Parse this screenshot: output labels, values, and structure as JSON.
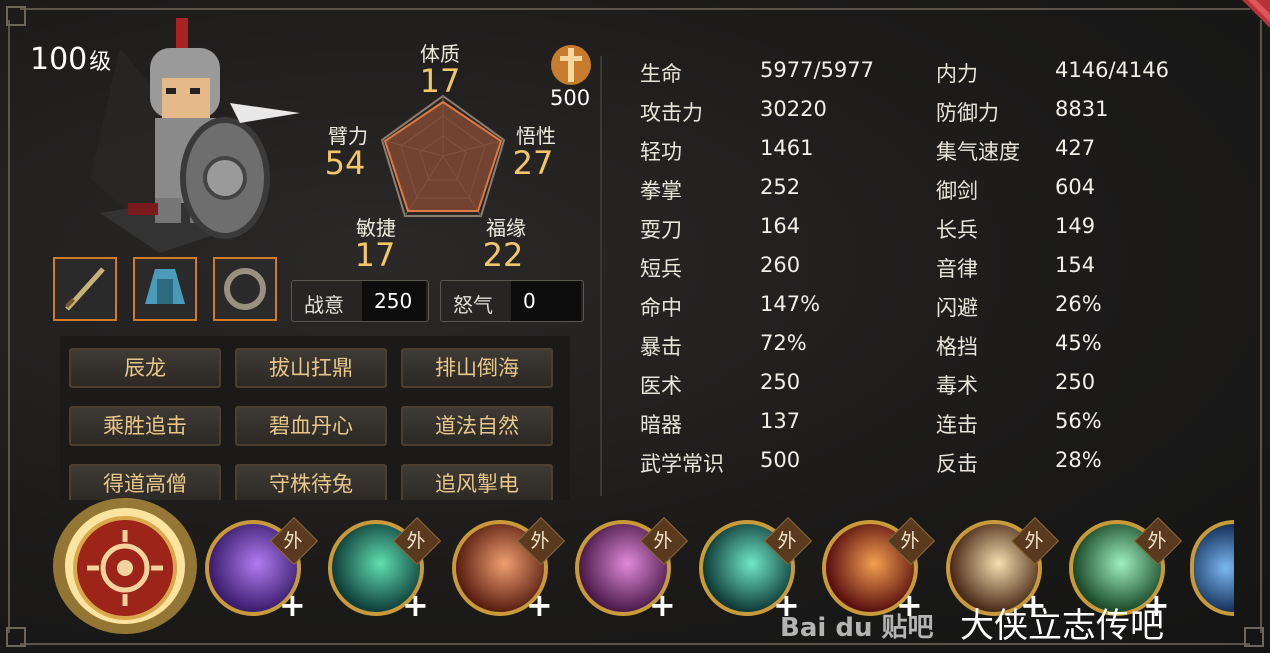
{
  "header": {
    "level_number": "100",
    "level_suffix": "级"
  },
  "badge": {
    "value": "500"
  },
  "attributes": {
    "tizhi": {
      "label": "体质",
      "value": "17"
    },
    "bili": {
      "label": "臂力",
      "value": "54"
    },
    "wuxing": {
      "label": "悟性",
      "value": "27"
    },
    "minjie": {
      "label": "敏捷",
      "value": "17"
    },
    "fuyuan": {
      "label": "福缘",
      "value": "22"
    }
  },
  "meters": {
    "zhanyi": {
      "label": "战意",
      "value": "250"
    },
    "nuqi": {
      "label": "怒气",
      "value": "0"
    }
  },
  "traits": [
    "辰龙",
    "拔山扛鼎",
    "排山倒海",
    "乘胜追击",
    "碧血丹心",
    "道法自然",
    "得道高僧",
    "守株待兔",
    "追风掣电"
  ],
  "stats_left": [
    {
      "label": "生命",
      "value": "5977/5977"
    },
    {
      "label": "攻击力",
      "value": "30220"
    },
    {
      "label": "轻功",
      "value": "1461"
    },
    {
      "label": "拳掌",
      "value": "252"
    },
    {
      "label": "耍刀",
      "value": "164"
    },
    {
      "label": "短兵",
      "value": "260"
    },
    {
      "label": "命中",
      "value": "147%"
    },
    {
      "label": "暴击",
      "value": "72%"
    },
    {
      "label": "医术",
      "value": "250"
    },
    {
      "label": "暗器",
      "value": "137"
    },
    {
      "label": "武学常识",
      "value": "500"
    }
  ],
  "stats_right": [
    {
      "label": "内力",
      "value": "4146/4146"
    },
    {
      "label": "防御力",
      "value": "8831"
    },
    {
      "label": "集气速度",
      "value": "427"
    },
    {
      "label": "御剑",
      "value": "604"
    },
    {
      "label": "长兵",
      "value": "149"
    },
    {
      "label": "音律",
      "value": "154"
    },
    {
      "label": "闪避",
      "value": "26%"
    },
    {
      "label": "格挡",
      "value": "45%"
    },
    {
      "label": "毒术",
      "value": "250"
    },
    {
      "label": "连击",
      "value": "56%"
    },
    {
      "label": "反击",
      "value": "28%"
    }
  ],
  "skill_tag": "外",
  "skill_plus": "+",
  "watermark": {
    "baidu": "Bai du 贴吧",
    "forum": "大侠立志传吧"
  },
  "colors": {
    "accent_gold": "#f3c66b",
    "equip_border": "#d07a2c",
    "trait_text": "#e9c68a"
  }
}
